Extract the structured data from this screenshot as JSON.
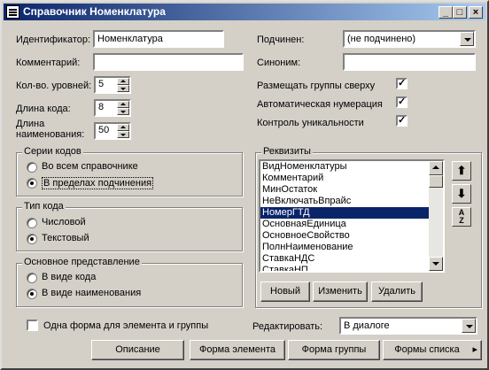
{
  "window": {
    "title": "Справочник Номенклатура",
    "min_glyph": "_",
    "max_glyph": "□",
    "close_glyph": "×"
  },
  "form": {
    "id_label": "Идентификатор:",
    "id_value": "Номенклатура",
    "comment_label": "Комментарий:",
    "comment_value": "",
    "levels_label": "Кол-во. уровней:",
    "levels_value": "5",
    "code_len_label": "Длина кода:",
    "code_len_value": "8",
    "name_len_label": "Длина наименования:",
    "name_len_value": "50",
    "subordinate_label": "Подчинен:",
    "subordinate_value": "(не подчинено)",
    "synonym_label": "Синоним:",
    "synonym_value": ""
  },
  "options": {
    "groups_top": {
      "label": "Размещать группы сверху",
      "checked": true
    },
    "auto_number": {
      "label": "Автоматическая нумерация",
      "checked": true
    },
    "uniqueness": {
      "label": "Контроль уникальности",
      "checked": true
    }
  },
  "code_series": {
    "title": "Серии кодов",
    "options": [
      "Во всем справочнике",
      "В пределах подчинения"
    ],
    "selected": 1
  },
  "code_type": {
    "title": "Тип кода",
    "options": [
      "Числовой",
      "Текстовый"
    ],
    "selected": 1
  },
  "main_view": {
    "title": "Основное представление",
    "options": [
      "В виде кода",
      "В виде наименования"
    ],
    "selected": 1
  },
  "requisites": {
    "title": "Реквизиты",
    "items": [
      "ВидНоменклатуры",
      "Комментарий",
      "МинОстаток",
      "НеВключатьВпрайс",
      "НомерГТД",
      "ОсновнаяЕдиница",
      "ОсновноеСвойство",
      "ПолнНаименование",
      "СтавкаНДС",
      "СтавкаНП"
    ],
    "selected_index": 4,
    "btn_new": "Новый",
    "btn_edit": "Изменить",
    "btn_delete": "Удалить"
  },
  "bottom": {
    "one_form_label": "Одна форма для элемента и группы",
    "one_form_checked": false,
    "edit_label": "Редактировать:",
    "edit_value": "В диалоге",
    "btn_description": "Описание",
    "btn_element_form": "Форма элемента",
    "btn_group_form": "Форма группы",
    "btn_list_forms": "Формы списка"
  }
}
